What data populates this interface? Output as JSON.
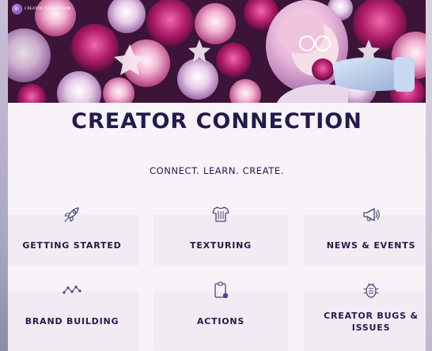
{
  "hero": {
    "brand_text": "Creator Connection"
  },
  "page": {
    "title": "CREATOR CONNECTION",
    "tagline": "CONNECT. LEARN. CREATE."
  },
  "categories": [
    {
      "label": "GETTING STARTED",
      "icon": "rocket-icon"
    },
    {
      "label": "TEXTURING",
      "icon": "tshirt-icon"
    },
    {
      "label": "NEWS & EVENTS",
      "icon": "megaphone-icon"
    },
    {
      "label": "BRAND BUILDING",
      "icon": "network-graph-icon"
    },
    {
      "label": "ACTIONS",
      "icon": "clipboard-icon"
    },
    {
      "label": "CREATOR BUGS & ISSUES",
      "icon": "bug-icon"
    }
  ],
  "colors": {
    "text": "#241a4c",
    "icon": "#4b4676",
    "tile_bg": "#f1ecf3",
    "page_bg": "#f7f3f8"
  }
}
